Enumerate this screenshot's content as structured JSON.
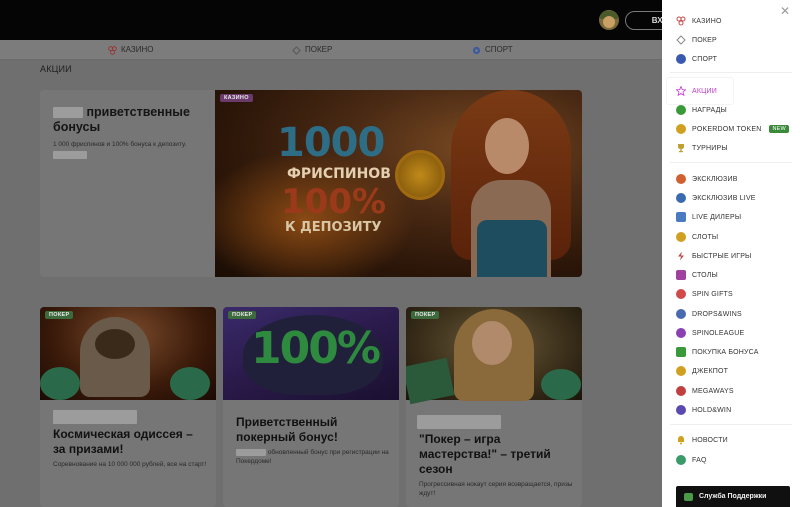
{
  "header": {
    "login_label": "ВХОД",
    "avatar_icon": "avatar-icon"
  },
  "category_nav": [
    {
      "label": "КАЗИНО",
      "icon": "casino-icon",
      "color": "#b03a3a"
    },
    {
      "label": "ПОКЕР",
      "icon": "poker-icon",
      "color": "#5a5a5a"
    },
    {
      "label": "СПОРТ",
      "icon": "sport-icon",
      "color": "#3a5aa0"
    }
  ],
  "page_title": "АКЦИИ",
  "hero": {
    "tag": "КАЗИНО",
    "title": "приветственные бонусы",
    "description": "1 000 фриспинов и 100% бонуса к депозиту.",
    "banner": {
      "line1": "1000",
      "line2": "ФРИСПИНОВ",
      "line3": "100%",
      "line4": "К ДЕПОЗИТУ"
    }
  },
  "cards": [
    {
      "tag": "ПОКЕР",
      "title": "Космическая одиссея – за призами!",
      "description": "Соревнование на 10 000 000 рублей, все на старт!"
    },
    {
      "tag": "ПОКЕР",
      "title": "Приветственный покерный бонус!",
      "description": "обновленный бонус при регистрации на Покердоме!",
      "banner": "100%"
    },
    {
      "tag": "ПОКЕР",
      "title": "\"Покер – игра мастерства!\" – третий сезон",
      "description": "Прогрессивная нокаут серия возвращается, призы ждут!"
    }
  ],
  "side_menu": {
    "group1": [
      {
        "label": "КАЗИНО",
        "icon": "casino-icon",
        "color": "#c84a4a"
      },
      {
        "label": "ПОКЕР",
        "icon": "poker-icon",
        "color": "#8a8a8a"
      },
      {
        "label": "СПОРТ",
        "icon": "sport-icon",
        "color": "#3a5ab0"
      }
    ],
    "group2": [
      {
        "label": "АКЦИИ",
        "icon": "star-icon",
        "color": "#c13bd0",
        "active": true
      },
      {
        "label": "НАГРАДЫ",
        "icon": "award-icon",
        "color": "#3a9a3a"
      },
      {
        "label": "POKERDOM TOKEN",
        "icon": "token-icon",
        "color": "#d0a020",
        "badge": "NEW"
      },
      {
        "label": "ТУРНИРЫ",
        "icon": "trophy-icon",
        "color": "#c0a030"
      }
    ],
    "group3": [
      {
        "label": "ЭКСКЛЮЗИВ",
        "icon": "exclusive-icon",
        "color": "#d06030"
      },
      {
        "label": "ЭКСКЛЮЗИВ LIVE",
        "icon": "exclusive-live-icon",
        "color": "#3a6ab0"
      },
      {
        "label": "LIVE ДИЛЕРЫ",
        "icon": "live-dealers-icon",
        "color": "#4a7ac0"
      },
      {
        "label": "СЛОТЫ",
        "icon": "slots-icon",
        "color": "#d0a020"
      },
      {
        "label": "БЫСТРЫЕ ИГРЫ",
        "icon": "fast-games-icon",
        "color": "#c04a4a"
      },
      {
        "label": "СТОЛЫ",
        "icon": "tables-icon",
        "color": "#a040a0"
      },
      {
        "label": "SPIN GIFTS",
        "icon": "spin-gifts-icon",
        "color": "#d04a4a"
      },
      {
        "label": "DROPS&WINS",
        "icon": "drops-wins-icon",
        "color": "#4a6ab0"
      },
      {
        "label": "SPINOLEAGUE",
        "icon": "spinoleague-icon",
        "color": "#8a40b0"
      },
      {
        "label": "ПОКУПКА БОНУСА",
        "icon": "bonus-buy-icon",
        "color": "#3a9a3a"
      },
      {
        "label": "ДЖЕКПОТ",
        "icon": "jackpot-icon",
        "color": "#d0a020"
      },
      {
        "label": "MEGAWAYS",
        "icon": "megaways-icon",
        "color": "#c04040"
      },
      {
        "label": "HOLD&WIN",
        "icon": "hold-win-icon",
        "color": "#5a4ab0"
      }
    ],
    "group4": [
      {
        "label": "НОВОСТИ",
        "icon": "news-icon",
        "color": "#d0a020"
      },
      {
        "label": "FAQ",
        "icon": "faq-icon",
        "color": "#3a9a6a"
      }
    ],
    "support_label": "Служба Поддержки"
  }
}
